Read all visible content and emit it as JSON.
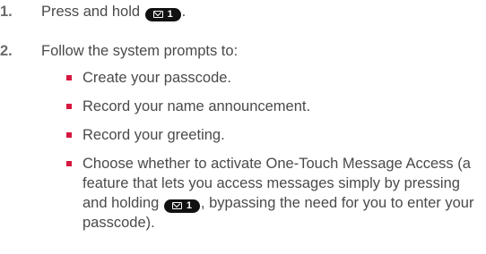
{
  "steps": [
    {
      "number": "1.",
      "text_before_key": "Press and hold",
      "text_after_key": "."
    },
    {
      "number": "2.",
      "text": "Follow the system prompts to:",
      "bullets": [
        {
          "text": "Create your passcode."
        },
        {
          "text": "Record your name announcement."
        },
        {
          "text": "Record your greeting."
        },
        {
          "text_before_key": "Choose whether to activate One-Touch Message Access (a feature that lets you access messages simply by pressing and holding",
          "text_after_key": ", bypassing the need for you to enter your passcode)."
        }
      ]
    }
  ],
  "key_label": "1",
  "colors": {
    "text": "#4a4a4a",
    "number": "#6b6b6b",
    "bullet": "#d6183f",
    "key_background": "#111111",
    "key_foreground": "#ffffff"
  },
  "icons": {
    "key_icon": "voicemail-envelope-icon"
  }
}
